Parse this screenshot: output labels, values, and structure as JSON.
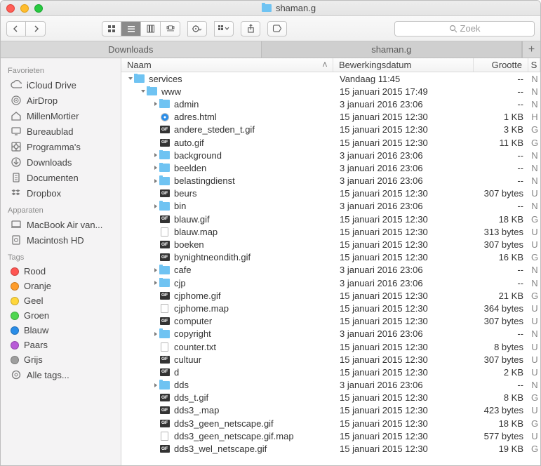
{
  "window_title": "shaman.g",
  "search_placeholder": "Zoek",
  "tabs": [
    {
      "label": "Downloads",
      "active": false
    },
    {
      "label": "shaman.g",
      "active": true
    }
  ],
  "sidebar": {
    "favorites_header": "Favorieten",
    "favorites": [
      {
        "label": "iCloud Drive",
        "icon": "cloud"
      },
      {
        "label": "AirDrop",
        "icon": "airdrop"
      },
      {
        "label": "MillenMortier",
        "icon": "home"
      },
      {
        "label": "Bureaublad",
        "icon": "desktop"
      },
      {
        "label": "Programma's",
        "icon": "apps"
      },
      {
        "label": "Downloads",
        "icon": "download"
      },
      {
        "label": "Documenten",
        "icon": "doc"
      },
      {
        "label": "Dropbox",
        "icon": "dropbox"
      }
    ],
    "devices_header": "Apparaten",
    "devices": [
      {
        "label": "MacBook Air van...",
        "icon": "mac"
      },
      {
        "label": "Macintosh HD",
        "icon": "disk"
      }
    ],
    "tags_header": "Tags",
    "tags": [
      {
        "label": "Rood",
        "color": "#ff5552"
      },
      {
        "label": "Oranje",
        "color": "#ff9c2b"
      },
      {
        "label": "Geel",
        "color": "#ffd63b"
      },
      {
        "label": "Groen",
        "color": "#4fd650"
      },
      {
        "label": "Blauw",
        "color": "#2a8de8"
      },
      {
        "label": "Paars",
        "color": "#b85bd7"
      },
      {
        "label": "Grijs",
        "color": "#9e9e9e"
      },
      {
        "label": "Alle tags...",
        "color": null
      }
    ]
  },
  "columns": {
    "name": "Naam",
    "date": "Bewerkingsdatum",
    "size": "Grootte",
    "extra": "S"
  },
  "rows": [
    {
      "depth": 0,
      "name": "services",
      "kind": "folder",
      "disclose": "down",
      "date": "Vandaag 11:45",
      "size": "--",
      "s": "N"
    },
    {
      "depth": 1,
      "name": "www",
      "kind": "folder",
      "disclose": "down",
      "date": "15 januari 2015 17:49",
      "size": "--",
      "s": "N"
    },
    {
      "depth": 2,
      "name": "admin",
      "kind": "folder",
      "disclose": "right",
      "date": "3 januari 2016 23:06",
      "size": "--",
      "s": "N"
    },
    {
      "depth": 2,
      "name": "adres.html",
      "kind": "safari",
      "date": "15 januari 2015 12:30",
      "size": "1 KB",
      "s": "H"
    },
    {
      "depth": 2,
      "name": "andere_steden_t.gif",
      "kind": "image",
      "date": "15 januari 2015 12:30",
      "size": "3 KB",
      "s": "G"
    },
    {
      "depth": 2,
      "name": "auto.gif",
      "kind": "image",
      "date": "15 januari 2015 12:30",
      "size": "11 KB",
      "s": "G"
    },
    {
      "depth": 2,
      "name": "background",
      "kind": "folder",
      "disclose": "right",
      "date": "3 januari 2016 23:06",
      "size": "--",
      "s": "N"
    },
    {
      "depth": 2,
      "name": "beelden",
      "kind": "folder",
      "disclose": "right",
      "date": "3 januari 2016 23:06",
      "size": "--",
      "s": "N"
    },
    {
      "depth": 2,
      "name": "belastingdienst",
      "kind": "folder",
      "disclose": "right",
      "date": "3 januari 2016 23:06",
      "size": "--",
      "s": "N"
    },
    {
      "depth": 2,
      "name": "beurs",
      "kind": "image",
      "date": "15 januari 2015 12:30",
      "size": "307 bytes",
      "s": "U"
    },
    {
      "depth": 2,
      "name": "bin",
      "kind": "folder",
      "disclose": "right",
      "date": "3 januari 2016 23:06",
      "size": "--",
      "s": "N"
    },
    {
      "depth": 2,
      "name": "blauw.gif",
      "kind": "image",
      "date": "15 januari 2015 12:30",
      "size": "18 KB",
      "s": "G"
    },
    {
      "depth": 2,
      "name": "blauw.map",
      "kind": "doc",
      "date": "15 januari 2015 12:30",
      "size": "313 bytes",
      "s": "U"
    },
    {
      "depth": 2,
      "name": "boeken",
      "kind": "image",
      "date": "15 januari 2015 12:30",
      "size": "307 bytes",
      "s": "U"
    },
    {
      "depth": 2,
      "name": "bynightneondith.gif",
      "kind": "image",
      "date": "15 januari 2015 12:30",
      "size": "16 KB",
      "s": "G"
    },
    {
      "depth": 2,
      "name": "cafe",
      "kind": "folder",
      "disclose": "right",
      "date": "3 januari 2016 23:06",
      "size": "--",
      "s": "N"
    },
    {
      "depth": 2,
      "name": "cjp",
      "kind": "folder",
      "disclose": "right",
      "date": "3 januari 2016 23:06",
      "size": "--",
      "s": "N"
    },
    {
      "depth": 2,
      "name": "cjphome.gif",
      "kind": "image",
      "date": "15 januari 2015 12:30",
      "size": "21 KB",
      "s": "G"
    },
    {
      "depth": 2,
      "name": "cjphome.map",
      "kind": "doc",
      "date": "15 januari 2015 12:30",
      "size": "364 bytes",
      "s": "U"
    },
    {
      "depth": 2,
      "name": "computer",
      "kind": "image",
      "date": "15 januari 2015 12:30",
      "size": "307 bytes",
      "s": "U"
    },
    {
      "depth": 2,
      "name": "copyright",
      "kind": "folder",
      "disclose": "right",
      "date": "3 januari 2016 23:06",
      "size": "--",
      "s": "N"
    },
    {
      "depth": 2,
      "name": "counter.txt",
      "kind": "doc",
      "date": "15 januari 2015 12:30",
      "size": "8 bytes",
      "s": "U"
    },
    {
      "depth": 2,
      "name": "cultuur",
      "kind": "image",
      "date": "15 januari 2015 12:30",
      "size": "307 bytes",
      "s": "U"
    },
    {
      "depth": 2,
      "name": "d",
      "kind": "image",
      "date": "15 januari 2015 12:30",
      "size": "2 KB",
      "s": "U"
    },
    {
      "depth": 2,
      "name": "dds",
      "kind": "folder",
      "disclose": "right",
      "date": "3 januari 2016 23:06",
      "size": "--",
      "s": "N"
    },
    {
      "depth": 2,
      "name": "dds_t.gif",
      "kind": "image",
      "date": "15 januari 2015 12:30",
      "size": "8 KB",
      "s": "G"
    },
    {
      "depth": 2,
      "name": "dds3_.map",
      "kind": "image",
      "date": "15 januari 2015 12:30",
      "size": "423 bytes",
      "s": "U"
    },
    {
      "depth": 2,
      "name": "dds3_geen_netscape.gif",
      "kind": "image",
      "date": "15 januari 2015 12:30",
      "size": "18 KB",
      "s": "G"
    },
    {
      "depth": 2,
      "name": "dds3_geen_netscape.gif.map",
      "kind": "doc",
      "date": "15 januari 2015 12:30",
      "size": "577 bytes",
      "s": "U"
    },
    {
      "depth": 2,
      "name": "dds3_wel_netscape.gif",
      "kind": "image",
      "date": "15 januari 2015 12:30",
      "size": "19 KB",
      "s": "G"
    }
  ]
}
